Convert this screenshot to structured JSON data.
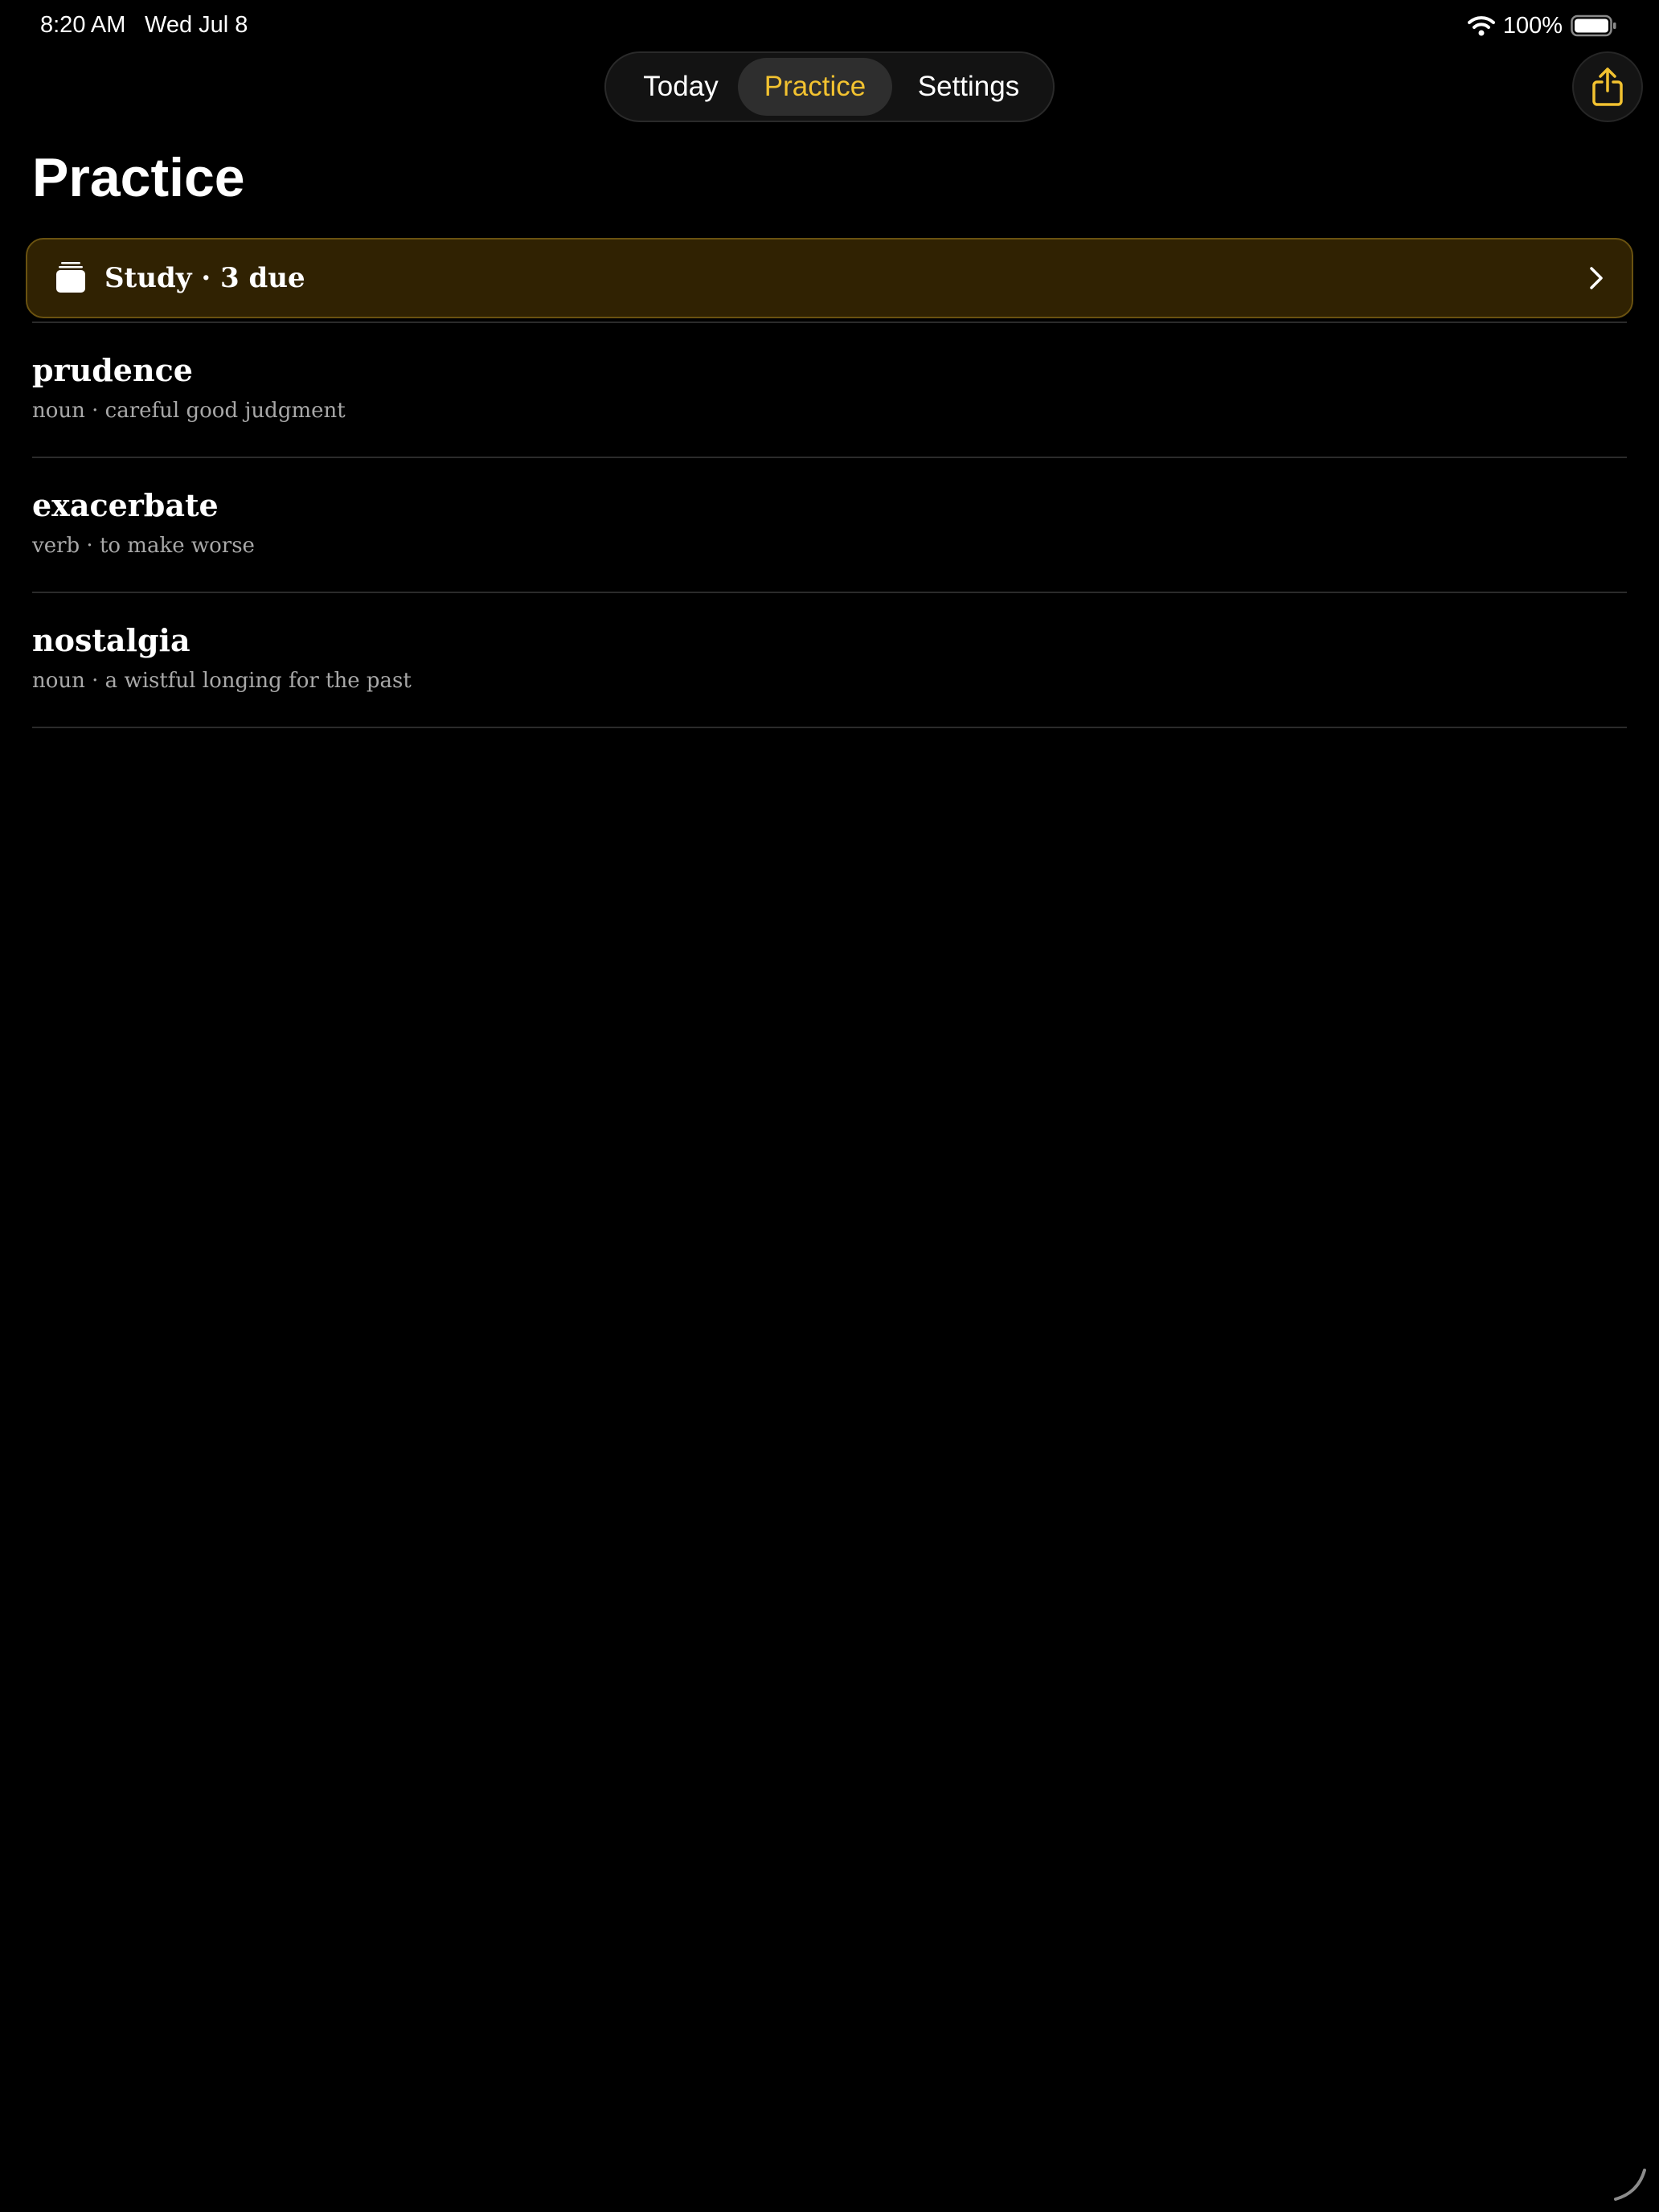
{
  "status_bar": {
    "time": "8:20 AM",
    "date": "Wed Jul 8",
    "battery_percent": "100%",
    "battery_level": 1.0,
    "icons": [
      "wifi-icon",
      "battery-icon"
    ]
  },
  "tabs": {
    "items": [
      {
        "label": "Today",
        "selected": false
      },
      {
        "label": "Practice",
        "selected": true
      },
      {
        "label": "Settings",
        "selected": false
      }
    ]
  },
  "header": {
    "share_icon": "share-icon"
  },
  "page": {
    "title": "Practice"
  },
  "study": {
    "label": "Study · 3 due",
    "icon": "stack-icon",
    "chevron": "chevron-right-icon"
  },
  "words": [
    {
      "term": "prudence",
      "meta": "noun · careful good judgment"
    },
    {
      "term": "exacerbate",
      "meta": "verb · to make worse"
    },
    {
      "term": "nostalgia",
      "meta": "noun · a wistful longing for the past"
    }
  ],
  "colors": {
    "background": "#000000",
    "accent": "#f2c230",
    "banner_fill": "#302202",
    "banner_border": "#6a5210",
    "secondary_text": "#a8a8a8",
    "divider": "#2b2b2b"
  }
}
